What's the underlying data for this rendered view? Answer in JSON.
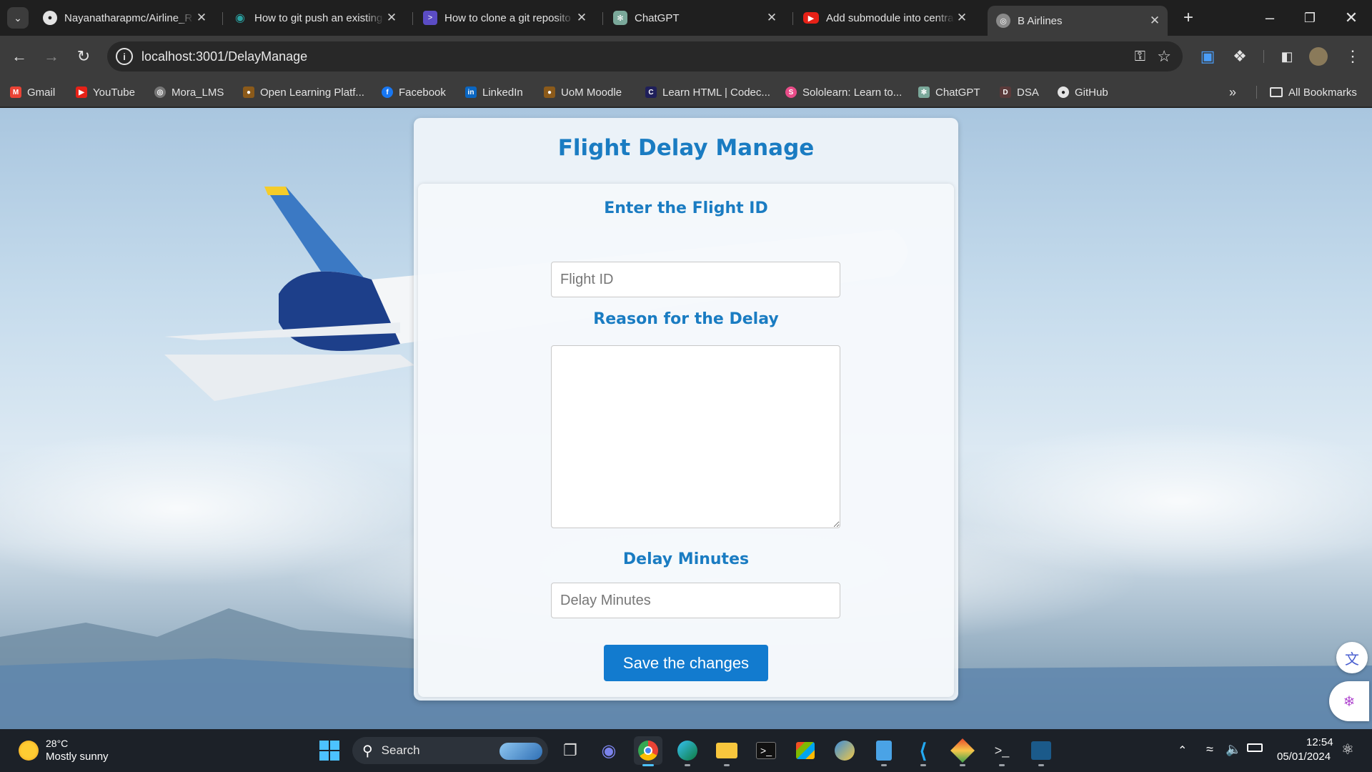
{
  "browser": {
    "tabs": [
      {
        "title": "Nayanatharapmc/Airline_R",
        "icon": "github-icon",
        "active": false
      },
      {
        "title": "How to git push an existing",
        "icon": "eye-icon",
        "active": false
      },
      {
        "title": "How to clone a git reposito",
        "icon": "terminal-icon",
        "active": false
      },
      {
        "title": "ChatGPT",
        "icon": "chatgpt-icon",
        "active": false
      },
      {
        "title": "Add submodule into centra",
        "icon": "youtube-icon",
        "active": false
      },
      {
        "title": "B Airlines",
        "icon": "globe-icon",
        "active": true
      }
    ],
    "url": "localhost:3001/DelayManage",
    "bookmarks": [
      {
        "label": "Gmail",
        "icon": "gmail-icon"
      },
      {
        "label": "YouTube",
        "icon": "youtube-icon"
      },
      {
        "label": "Mora_LMS",
        "icon": "globe-icon"
      },
      {
        "label": "Open Learning Platf...",
        "icon": "owl-icon"
      },
      {
        "label": "Facebook",
        "icon": "facebook-icon"
      },
      {
        "label": "LinkedIn",
        "icon": "linkedin-icon"
      },
      {
        "label": "UoM Moodle",
        "icon": "owl-icon"
      },
      {
        "label": "Learn HTML | Codec...",
        "icon": "codecademy-icon"
      },
      {
        "label": "Sololearn: Learn to...",
        "icon": "sololearn-icon"
      },
      {
        "label": "ChatGPT",
        "icon": "chatgpt-icon"
      },
      {
        "label": "DSA",
        "icon": "dsa-icon"
      },
      {
        "label": "GitHub",
        "icon": "github-icon"
      }
    ],
    "all_bookmarks": "All Bookmarks"
  },
  "form": {
    "title": "Flight Delay Manage",
    "flight_id_label": "Enter the Flight ID",
    "flight_id_placeholder": "Flight ID",
    "flight_id_value": "",
    "reason_label": "Reason for the Delay",
    "reason_value": "",
    "delay_label": "Delay Minutes",
    "delay_placeholder": "Delay Minutes",
    "delay_value": "",
    "save_label": "Save the changes"
  },
  "taskbar": {
    "weather_temp": "28°C",
    "weather_desc": "Mostly sunny",
    "search_label": "Search",
    "time": "12:54",
    "date": "05/01/2024"
  },
  "colors": {
    "accent": "#1a7cc2",
    "button": "#127bcf",
    "chrome_dark": "#1f1f1f",
    "chrome_toolbar": "#3c3c3c"
  }
}
